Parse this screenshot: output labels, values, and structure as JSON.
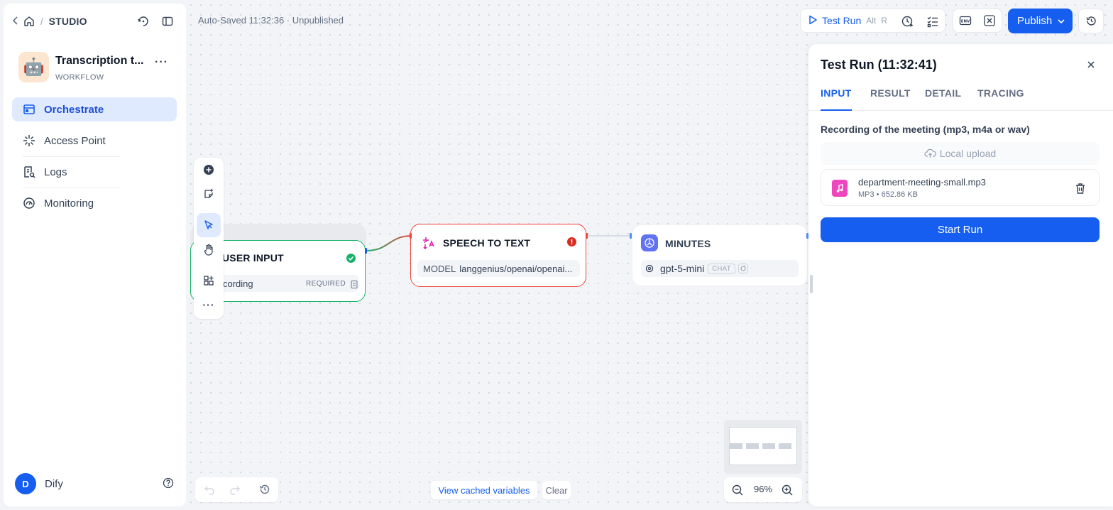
{
  "header": {
    "breadcrumb_section": "STUDIO",
    "autosave_status": "Auto-Saved 11:32:36 · Unpublished",
    "test_run_label": "Test Run",
    "test_run_shortcut_1": "Alt",
    "test_run_shortcut_2": "R",
    "publish_label": "Publish"
  },
  "app": {
    "name": "Transcription t...",
    "type": "WORKFLOW",
    "icon": "robot-emoji"
  },
  "sidebar": {
    "items": [
      {
        "label": "Orchestrate",
        "icon": "orchestrate-icon",
        "active": true
      },
      {
        "label": "Access Point",
        "icon": "access-point-icon",
        "active": false
      },
      {
        "label": "Logs",
        "icon": "logs-icon",
        "active": false
      },
      {
        "label": "Monitoring",
        "icon": "monitoring-icon",
        "active": false
      }
    ],
    "user": {
      "initial": "D",
      "name": "Dify"
    }
  },
  "nodes": {
    "user_input": {
      "title": "USER INPUT",
      "variable": "cording",
      "badge": "REQUIRED"
    },
    "speech_to_text": {
      "title": "SPEECH TO TEXT",
      "field_label": "MODEL",
      "field_value": "langgenius/openai/openai..."
    },
    "minutes": {
      "title": "MINUTES",
      "model": "gpt-5-mini",
      "model_mode": "CHAT"
    }
  },
  "canvas": {
    "view_cached_label": "View cached variables",
    "clear_label": "Clear",
    "zoom": "96%"
  },
  "panel": {
    "title": "Test Run (11:32:41)",
    "tabs": [
      "INPUT",
      "RESULT",
      "DETAIL",
      "TRACING"
    ],
    "active_tab": "INPUT",
    "field_label": "Recording of the meeting (mp3, m4a or wav)",
    "upload_label": "Local upload",
    "file": {
      "name": "department-meeting-small.mp3",
      "meta": "MP3 • 652.86 KB"
    },
    "start_label": "Start Run"
  },
  "colors": {
    "accent": "#155eef",
    "success": "#17b26a",
    "error": "#f04438",
    "active_nav_bg": "#e0eaff"
  }
}
